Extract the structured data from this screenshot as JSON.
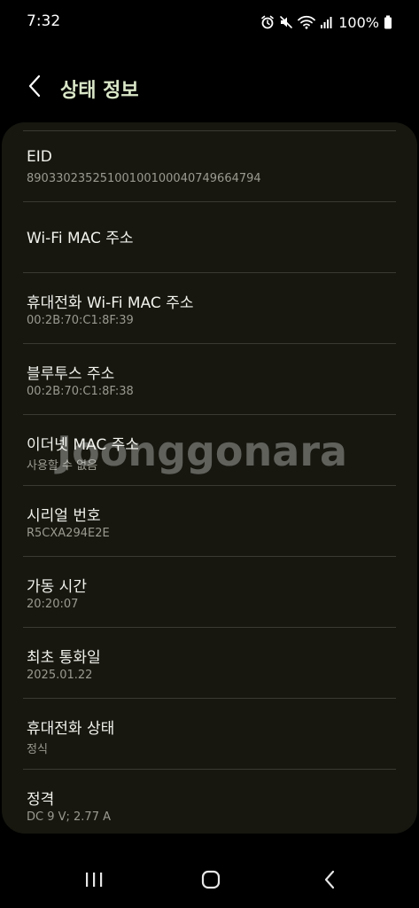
{
  "status_bar": {
    "time": "7:32",
    "battery": "100%",
    "icons": [
      "alarm-icon",
      "mute-icon",
      "wifi-icon",
      "signal-icon",
      "battery-icon"
    ]
  },
  "header": {
    "title": "상태 정보",
    "back_icon": "chevron-left-icon"
  },
  "items": [
    {
      "title": "EID",
      "value": "89033023525100100100040749664794"
    },
    {
      "title": "Wi-Fi MAC 주소",
      "value": ""
    },
    {
      "title": "휴대전화 Wi-Fi MAC 주소",
      "value": "00:2B:70:C1:8F:39"
    },
    {
      "title": "블루투스 주소",
      "value": "00:2B:70:C1:8F:38"
    },
    {
      "title": "이더넷 MAC 주소",
      "value": "사용할 수 없음"
    },
    {
      "title": "시리얼 번호",
      "value": "R5CXA294E2E"
    },
    {
      "title": "가동 시간",
      "value": "20:20:07"
    },
    {
      "title": "최초 통화일",
      "value": "2025.01.22"
    },
    {
      "title": "휴대전화 상태",
      "value": "정식"
    },
    {
      "title": "정격",
      "value": "DC 9 V; 2.77 A"
    }
  ],
  "watermark": "Joonggonara",
  "nav_bar": {
    "icons": [
      "recent-apps-icon",
      "home-icon",
      "back-icon"
    ]
  },
  "colors": {
    "background": "#000000",
    "card": "#171710",
    "title_accent": "#d9e6c7",
    "secondary_text": "#9a9a90",
    "divider": "#3a3a33"
  }
}
